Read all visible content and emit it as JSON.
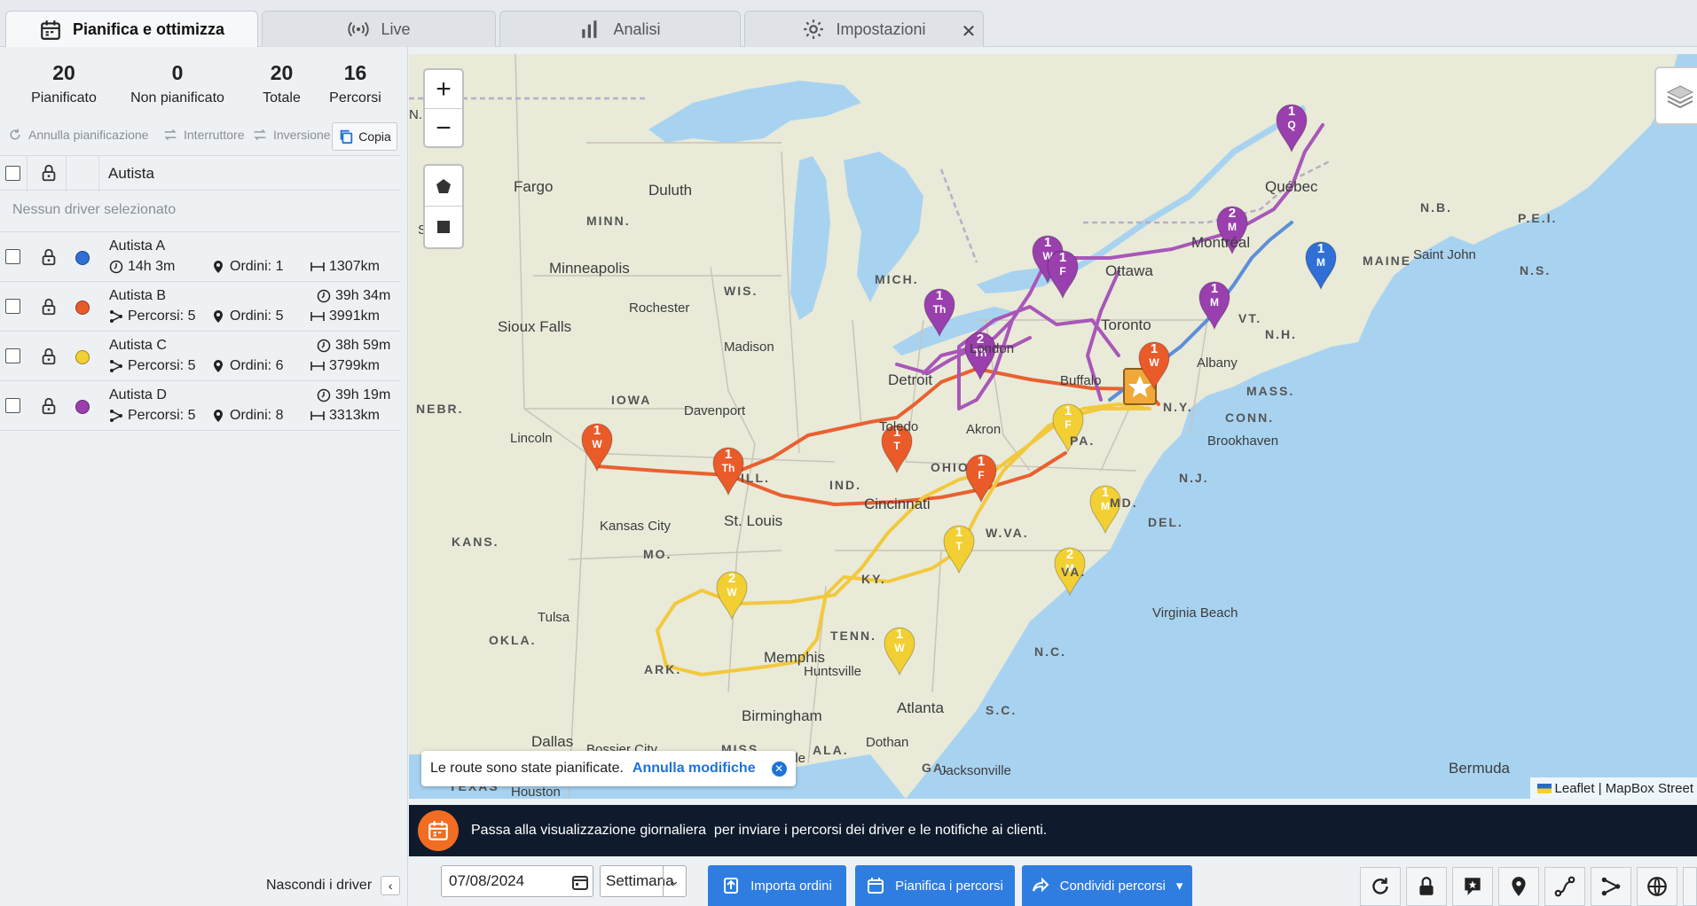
{
  "tabs": [
    {
      "label": "Pianifica e ottimizza",
      "icon": "calendar-icon",
      "active": true
    },
    {
      "label": "Live",
      "icon": "broadcast-icon",
      "active": false
    },
    {
      "label": "Analisi",
      "icon": "bar-chart-icon",
      "active": false
    },
    {
      "label": "Impostazioni",
      "icon": "gear-icon",
      "active": false
    }
  ],
  "stats": [
    {
      "value": "20",
      "label": "Pianificato"
    },
    {
      "value": "0",
      "label": "Non pianificato"
    },
    {
      "value": "20",
      "label": "Totale"
    },
    {
      "value": "16",
      "label": "Percorsi"
    }
  ],
  "actions": {
    "unplan": "Annulla pianificazione",
    "switch": "Interruttore",
    "invert": "Inversione",
    "copy": "Copia"
  },
  "table": {
    "driver_col": "Autista",
    "empty": "Nessun driver selezionato"
  },
  "drivers": [
    {
      "name": "Autista A",
      "color": "#2f6fd6",
      "time": "14h 3m",
      "routes": "",
      "orders": "Ordini: 1",
      "distance": "1307km"
    },
    {
      "name": "Autista B",
      "color": "#ea5b2a",
      "time": "39h 34m",
      "routes": "Percorsi: 5",
      "orders": "Ordini: 5",
      "distance": "3991km"
    },
    {
      "name": "Autista C",
      "color": "#f2d033",
      "time": "38h 59m",
      "routes": "Percorsi: 5",
      "orders": "Ordini: 6",
      "distance": "3799km"
    },
    {
      "name": "Autista D",
      "color": "#9a3fae",
      "time": "39h 19m",
      "routes": "Percorsi: 5",
      "orders": "Ordini: 8",
      "distance": "3313km"
    }
  ],
  "hide_drivers": "Nascondi i driver",
  "map": {
    "labels": {
      "fargo": "Fargo",
      "duluth": "Duluth",
      "minn": "MINN.",
      "minneapolis": "Minneapolis",
      "wis": "WIS.",
      "mich": "MICH.",
      "rochester": "Rochester",
      "sioux": "Sioux Falls",
      "madison": "Madison",
      "iowa": "IOWA",
      "davenport": "Davenport",
      "nebr": "NEBR.",
      "lincoln": "Lincoln",
      "ill": "ILL.",
      "ind": "IND.",
      "ohio": "OHIO",
      "toledo": "Toledo",
      "akron": "Akron",
      "detroit": "Detroit",
      "london": "London",
      "toronto": "Toronto",
      "buffalo": "Buffalo",
      "ottawa": "Ottawa",
      "montreal": "Montréal",
      "quebec": "Québec",
      "maine": "MAINE",
      "nb": "N.B.",
      "pei": "P.E.I.",
      "ns": "N.S.",
      "saintjohn": "Saint John",
      "vt": "VT.",
      "nh": "N.H.",
      "albany": "Albany",
      "mass": "MASS.",
      "conn": "CONN.",
      "brookhaven": "Brookhaven",
      "ny": "N.Y.",
      "pa": "PA.",
      "nj": "N.J.",
      "md": "MD.",
      "del": "DEL.",
      "wva": "W.VA.",
      "va": "VA.",
      "kans": "KANS.",
      "kc": "Kansas City",
      "mo": "MO.",
      "stlouis": "St. Louis",
      "cincinnati": "Cincinnati",
      "ky": "KY.",
      "tulsa": "Tulsa",
      "okla": "OKLA.",
      "ark": "ARK.",
      "tenn": "TENN.",
      "memphis": "Memphis",
      "huntsville": "Huntsville",
      "nc": "N.C.",
      "vbeach": "Virginia Beach",
      "birmingham": "Birmingham",
      "atlanta": "Atlanta",
      "sc": "S.C.",
      "dallas": "Dallas",
      "bossier": "Bossier City",
      "miss": "MISS.",
      "ala": "ALA.",
      "ga": "GA.",
      "texas": "TEXAS",
      "dothan": "Dothan",
      "jacksonville": "Jacksonville",
      "houston": "Houston",
      "bermuda": "Bermuda",
      "n": "N.",
      "s": "S",
      "lle": "lle"
    },
    "markers": [
      {
        "num": "1",
        "day": "Q",
        "color": "#9a3fae"
      },
      {
        "num": "2",
        "day": "M",
        "color": "#9a3fae"
      },
      {
        "num": "1",
        "day": "M",
        "color": "#2f6fd6"
      },
      {
        "num": "1",
        "day": "W",
        "color": "#9a3fae"
      },
      {
        "num": "1",
        "day": "F",
        "color": "#9a3fae"
      },
      {
        "num": "1",
        "day": "M",
        "color": "#9a3fae"
      },
      {
        "num": "1",
        "day": "Th",
        "color": "#9a3fae"
      },
      {
        "num": "2",
        "day": "Th",
        "color": "#9a3fae"
      },
      {
        "num": "1",
        "day": "W",
        "color": "#ea5b2a"
      },
      {
        "num": "1",
        "day": "F",
        "color": "#f2d033"
      },
      {
        "num": "1",
        "day": "W",
        "color": "#ea5b2a"
      },
      {
        "num": "1",
        "day": "Th",
        "color": "#ea5b2a"
      },
      {
        "num": "1",
        "day": "T",
        "color": "#ea5b2a"
      },
      {
        "num": "1",
        "day": "F",
        "color": "#ea5b2a"
      },
      {
        "num": "1",
        "day": "M",
        "color": "#f2d033"
      },
      {
        "num": "1",
        "day": "T",
        "color": "#f2d033"
      },
      {
        "num": "2",
        "day": "M",
        "color": "#f2d033"
      },
      {
        "num": "2",
        "day": "W",
        "color": "#f2d033"
      },
      {
        "num": "1",
        "day": "W",
        "color": "#f2d033"
      }
    ],
    "attribution": "Leaflet | MapBox Street",
    "toast": {
      "message": "Le route sono state pianificate.",
      "undo": "Annulla modifiche"
    }
  },
  "banner": "Passa alla visualizzazione giornaliera  per inviare i percorsi dei driver e le notifiche ai clienti.",
  "toolbar": {
    "date": "07/08/2024",
    "period": "Settimana",
    "import": "Importa ordini",
    "plan": "Pianifica i percorsi",
    "share": "Condividi percorsi"
  }
}
